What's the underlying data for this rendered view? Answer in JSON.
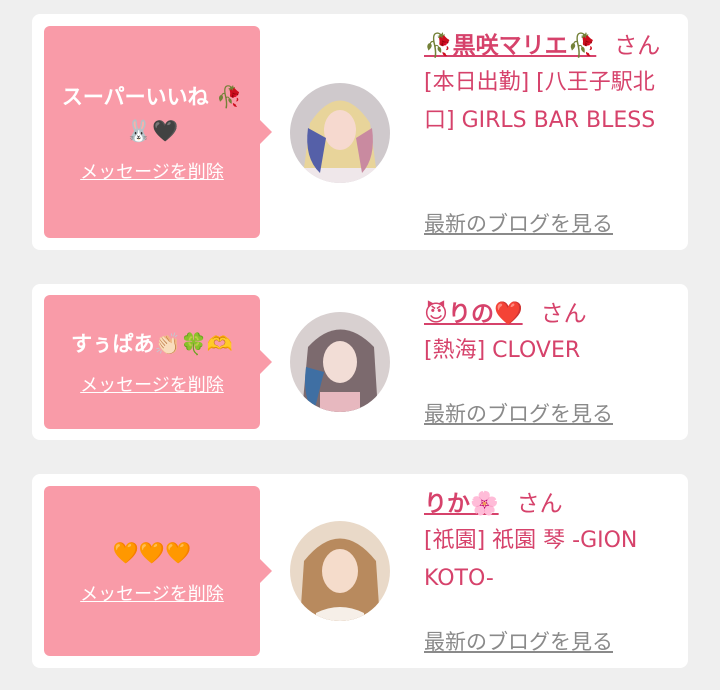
{
  "cards": [
    {
      "message": "スーパーいいね 🥀 🐰🖤",
      "delete_label": "メッセージを削除",
      "name": "🥀黒咲マリエ🥀",
      "honorific": "さん",
      "shop": "[本日出勤] [八王子駅北口] GIRLS BAR BLESS",
      "blog_link": "最新のブログを見る"
    },
    {
      "message": "すぅぱあ👏🏻🍀🫶",
      "delete_label": "メッセージを削除",
      "name": "😈りの❤️",
      "honorific": "さん",
      "shop": "[熱海] CLOVER",
      "blog_link": "最新のブログを見る"
    },
    {
      "message": "🧡🧡🧡",
      "delete_label": "メッセージを削除",
      "name": "りか🌸",
      "honorific": "さん",
      "shop": "[祇園] 祇園 琴 -GION KOTO-",
      "blog_link": "最新のブログを見る"
    }
  ],
  "colors": {
    "accent": "#d6426b",
    "bubble": "#f99ba8",
    "background": "#efefef"
  }
}
